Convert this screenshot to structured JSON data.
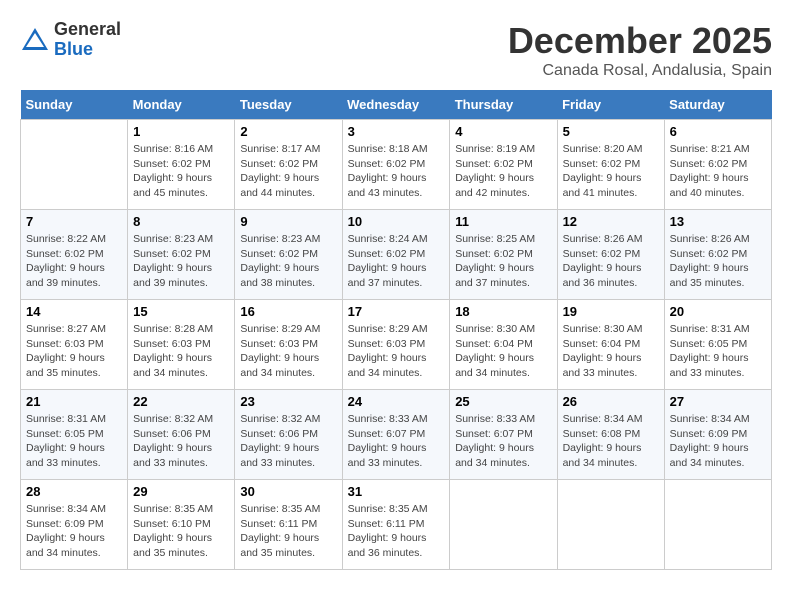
{
  "logo": {
    "general": "General",
    "blue": "Blue"
  },
  "title": "December 2025",
  "subtitle": "Canada Rosal, Andalusia, Spain",
  "days_of_week": [
    "Sunday",
    "Monday",
    "Tuesday",
    "Wednesday",
    "Thursday",
    "Friday",
    "Saturday"
  ],
  "weeks": [
    [
      {
        "day": "",
        "info": ""
      },
      {
        "day": "1",
        "info": "Sunrise: 8:16 AM\nSunset: 6:02 PM\nDaylight: 9 hours\nand 45 minutes."
      },
      {
        "day": "2",
        "info": "Sunrise: 8:17 AM\nSunset: 6:02 PM\nDaylight: 9 hours\nand 44 minutes."
      },
      {
        "day": "3",
        "info": "Sunrise: 8:18 AM\nSunset: 6:02 PM\nDaylight: 9 hours\nand 43 minutes."
      },
      {
        "day": "4",
        "info": "Sunrise: 8:19 AM\nSunset: 6:02 PM\nDaylight: 9 hours\nand 42 minutes."
      },
      {
        "day": "5",
        "info": "Sunrise: 8:20 AM\nSunset: 6:02 PM\nDaylight: 9 hours\nand 41 minutes."
      },
      {
        "day": "6",
        "info": "Sunrise: 8:21 AM\nSunset: 6:02 PM\nDaylight: 9 hours\nand 40 minutes."
      }
    ],
    [
      {
        "day": "7",
        "info": "Sunrise: 8:22 AM\nSunset: 6:02 PM\nDaylight: 9 hours\nand 39 minutes."
      },
      {
        "day": "8",
        "info": "Sunrise: 8:23 AM\nSunset: 6:02 PM\nDaylight: 9 hours\nand 39 minutes."
      },
      {
        "day": "9",
        "info": "Sunrise: 8:23 AM\nSunset: 6:02 PM\nDaylight: 9 hours\nand 38 minutes."
      },
      {
        "day": "10",
        "info": "Sunrise: 8:24 AM\nSunset: 6:02 PM\nDaylight: 9 hours\nand 37 minutes."
      },
      {
        "day": "11",
        "info": "Sunrise: 8:25 AM\nSunset: 6:02 PM\nDaylight: 9 hours\nand 37 minutes."
      },
      {
        "day": "12",
        "info": "Sunrise: 8:26 AM\nSunset: 6:02 PM\nDaylight: 9 hours\nand 36 minutes."
      },
      {
        "day": "13",
        "info": "Sunrise: 8:26 AM\nSunset: 6:02 PM\nDaylight: 9 hours\nand 35 minutes."
      }
    ],
    [
      {
        "day": "14",
        "info": "Sunrise: 8:27 AM\nSunset: 6:03 PM\nDaylight: 9 hours\nand 35 minutes."
      },
      {
        "day": "15",
        "info": "Sunrise: 8:28 AM\nSunset: 6:03 PM\nDaylight: 9 hours\nand 34 minutes."
      },
      {
        "day": "16",
        "info": "Sunrise: 8:29 AM\nSunset: 6:03 PM\nDaylight: 9 hours\nand 34 minutes."
      },
      {
        "day": "17",
        "info": "Sunrise: 8:29 AM\nSunset: 6:03 PM\nDaylight: 9 hours\nand 34 minutes."
      },
      {
        "day": "18",
        "info": "Sunrise: 8:30 AM\nSunset: 6:04 PM\nDaylight: 9 hours\nand 34 minutes."
      },
      {
        "day": "19",
        "info": "Sunrise: 8:30 AM\nSunset: 6:04 PM\nDaylight: 9 hours\nand 33 minutes."
      },
      {
        "day": "20",
        "info": "Sunrise: 8:31 AM\nSunset: 6:05 PM\nDaylight: 9 hours\nand 33 minutes."
      }
    ],
    [
      {
        "day": "21",
        "info": "Sunrise: 8:31 AM\nSunset: 6:05 PM\nDaylight: 9 hours\nand 33 minutes."
      },
      {
        "day": "22",
        "info": "Sunrise: 8:32 AM\nSunset: 6:06 PM\nDaylight: 9 hours\nand 33 minutes."
      },
      {
        "day": "23",
        "info": "Sunrise: 8:32 AM\nSunset: 6:06 PM\nDaylight: 9 hours\nand 33 minutes."
      },
      {
        "day": "24",
        "info": "Sunrise: 8:33 AM\nSunset: 6:07 PM\nDaylight: 9 hours\nand 33 minutes."
      },
      {
        "day": "25",
        "info": "Sunrise: 8:33 AM\nSunset: 6:07 PM\nDaylight: 9 hours\nand 34 minutes."
      },
      {
        "day": "26",
        "info": "Sunrise: 8:34 AM\nSunset: 6:08 PM\nDaylight: 9 hours\nand 34 minutes."
      },
      {
        "day": "27",
        "info": "Sunrise: 8:34 AM\nSunset: 6:09 PM\nDaylight: 9 hours\nand 34 minutes."
      }
    ],
    [
      {
        "day": "28",
        "info": "Sunrise: 8:34 AM\nSunset: 6:09 PM\nDaylight: 9 hours\nand 34 minutes."
      },
      {
        "day": "29",
        "info": "Sunrise: 8:35 AM\nSunset: 6:10 PM\nDaylight: 9 hours\nand 35 minutes."
      },
      {
        "day": "30",
        "info": "Sunrise: 8:35 AM\nSunset: 6:11 PM\nDaylight: 9 hours\nand 35 minutes."
      },
      {
        "day": "31",
        "info": "Sunrise: 8:35 AM\nSunset: 6:11 PM\nDaylight: 9 hours\nand 36 minutes."
      },
      {
        "day": "",
        "info": ""
      },
      {
        "day": "",
        "info": ""
      },
      {
        "day": "",
        "info": ""
      }
    ]
  ]
}
